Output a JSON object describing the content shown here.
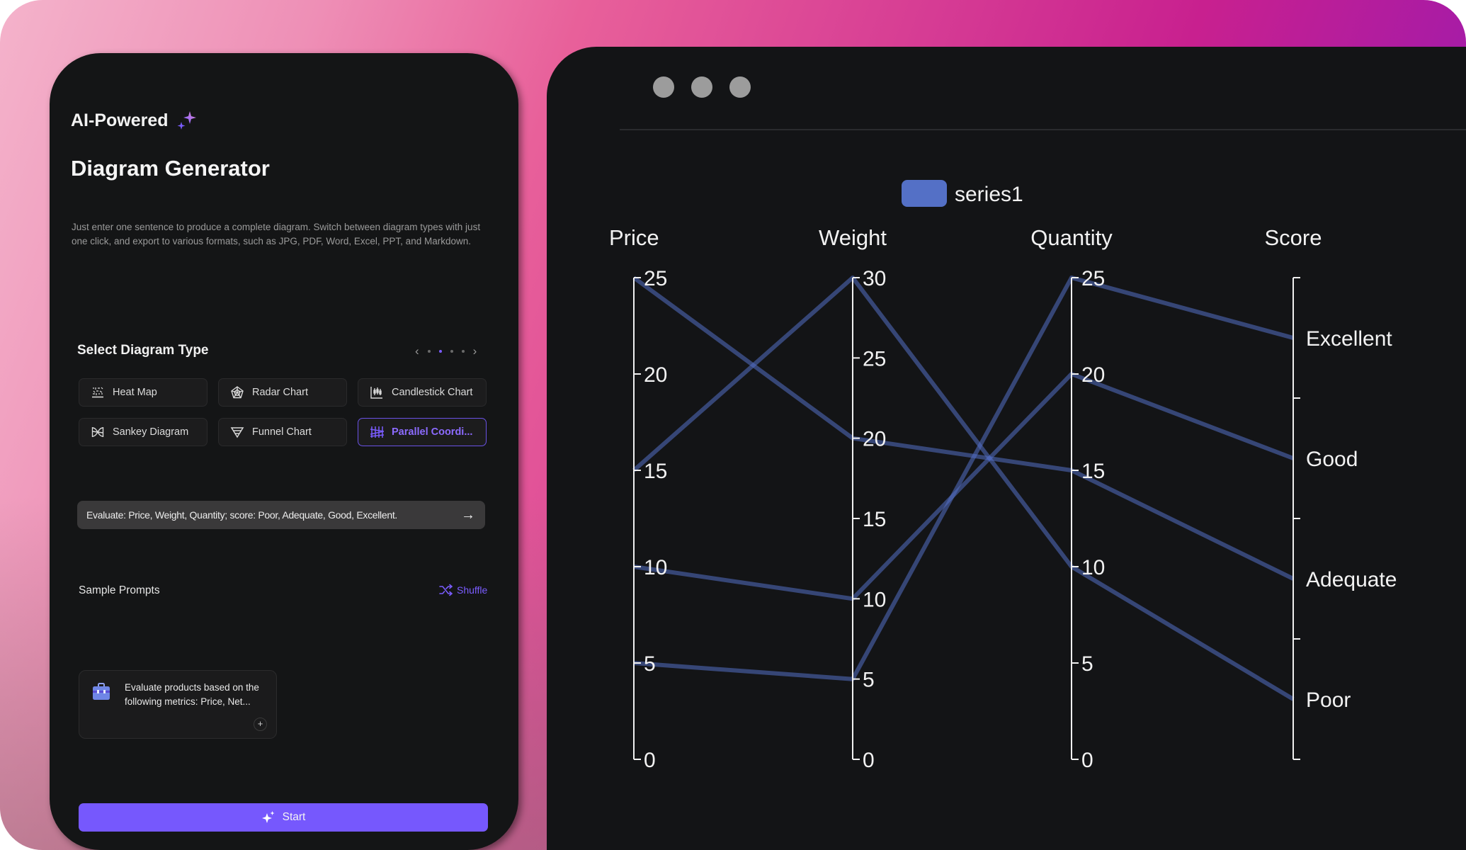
{
  "left_panel": {
    "badge_title": "AI-Powered",
    "title": "Diagram Generator",
    "description": "Just enter one sentence to produce a complete diagram. Switch between diagram types with just one click, and export to various formats, such as JPG, PDF, Word, Excel, PPT, and Markdown.",
    "select_type": {
      "title": "Select Diagram Type",
      "pager": {
        "pages": 4,
        "active_page": 2,
        "prev_icon": "chevron-left-icon",
        "next_icon": "chevron-right-icon"
      },
      "types": [
        {
          "label": "Heat Map",
          "icon": "heat-map-icon",
          "active": false
        },
        {
          "label": "Radar Chart",
          "icon": "radar-chart-icon",
          "active": false
        },
        {
          "label": "Candlestick Chart",
          "icon": "candlestick-chart-icon",
          "active": false
        },
        {
          "label": "Sankey Diagram",
          "icon": "sankey-diagram-icon",
          "active": false
        },
        {
          "label": "Funnel Chart",
          "icon": "funnel-chart-icon",
          "active": false
        },
        {
          "label": "Parallel Coordi...",
          "icon": "parallel-coordinates-icon",
          "active": true
        }
      ]
    },
    "prompt_input": {
      "value": "Evaluate: Price, Weight, Quantity; score: Poor, Adequate, Good, Excellent.",
      "send_icon": "arrow-right-icon"
    },
    "sample_prompts": {
      "title": "Sample Prompts",
      "shuffle_label": "Shuffle",
      "cards": [
        {
          "text": "Evaluate products based on the following metrics: Price, Net...",
          "icon": "briefcase-icon",
          "add_icon": "plus-icon"
        }
      ]
    },
    "start_button": "Start"
  },
  "colors": {
    "accent": "#7658fd",
    "series": "#5470c6",
    "panel_bg": "#141516",
    "chart_bg": "#131416"
  },
  "chart_data": {
    "type": "parallel",
    "legend": [
      {
        "name": "series1",
        "color": "#5470c6"
      }
    ],
    "legend_position": "top-center",
    "axes": [
      {
        "name": "Price",
        "type": "value",
        "range": [
          0,
          25
        ],
        "ticks": [
          0,
          5,
          10,
          15,
          20,
          25
        ]
      },
      {
        "name": "Weight",
        "type": "value",
        "range": [
          0,
          30
        ],
        "ticks": [
          0,
          5,
          10,
          15,
          20,
          25,
          30
        ]
      },
      {
        "name": "Quantity",
        "type": "value",
        "range": [
          0,
          25
        ],
        "ticks": [
          0,
          5,
          10,
          15,
          20,
          25
        ]
      },
      {
        "name": "Score",
        "type": "category",
        "categories": [
          "Poor",
          "Adequate",
          "Good",
          "Excellent"
        ]
      }
    ],
    "series": [
      {
        "name": "series1",
        "data": [
          [
            25,
            20,
            15,
            "Adequate"
          ],
          [
            15,
            30,
            10,
            "Poor"
          ],
          [
            10,
            10,
            20,
            "Good"
          ],
          [
            5,
            5,
            25,
            "Excellent"
          ]
        ]
      }
    ]
  }
}
